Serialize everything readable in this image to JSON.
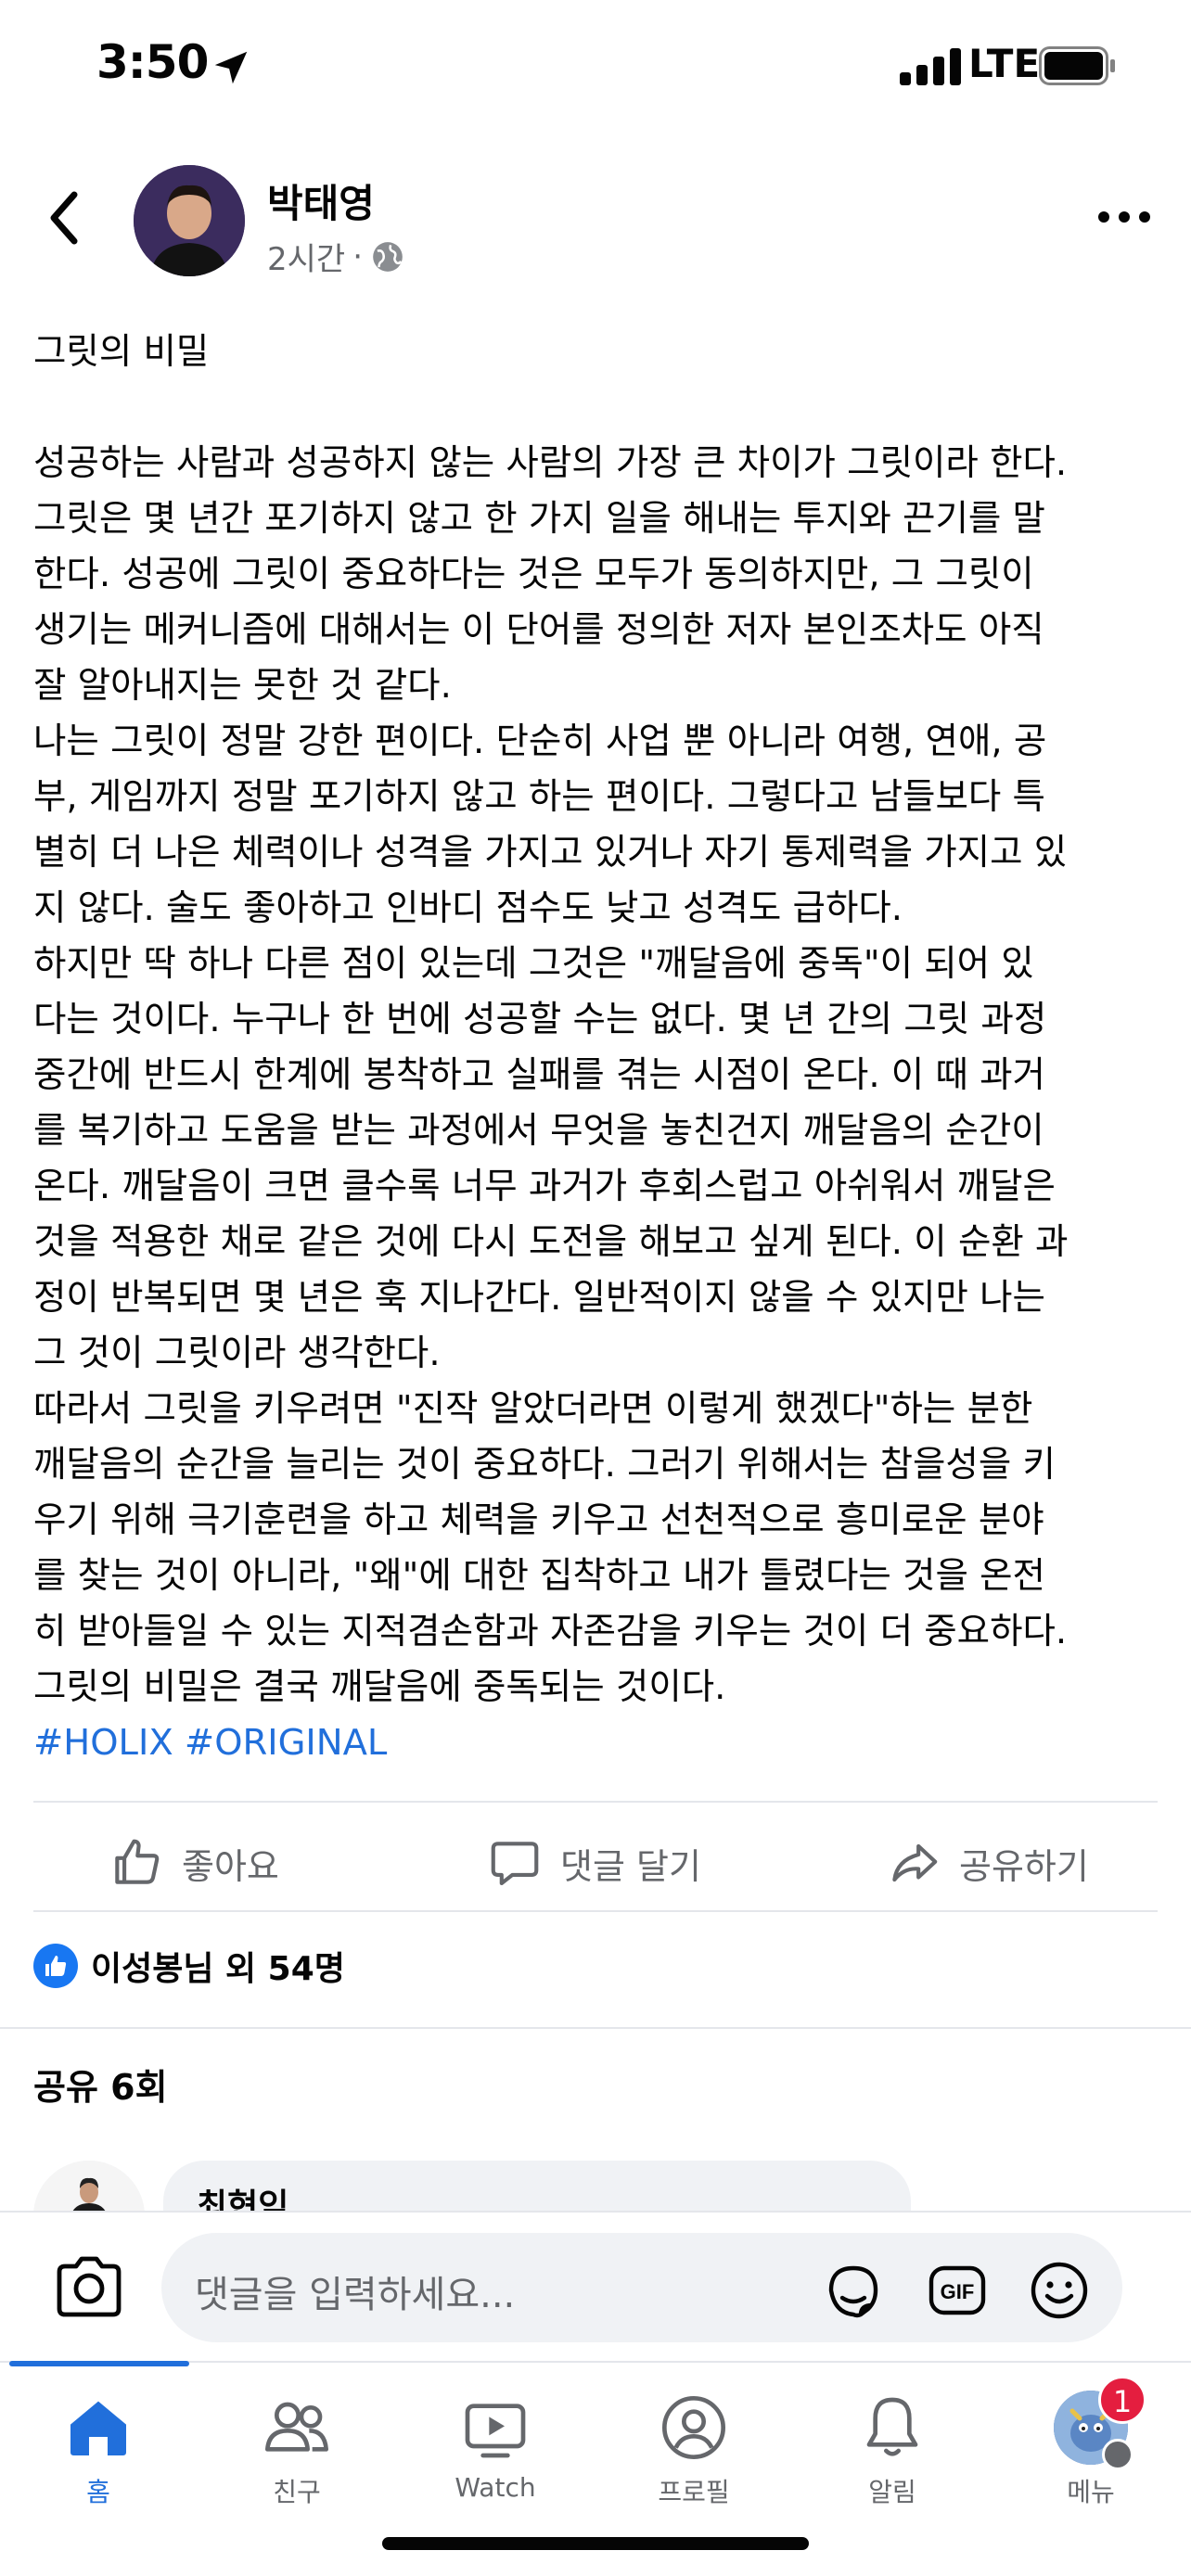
{
  "status_bar": {
    "time": "3:50",
    "network": "LTE"
  },
  "post": {
    "author": "박태영",
    "time_ago": "2시간",
    "separator": "·",
    "lines": [
      "그릿의 비밀",
      "",
      "성공하는 사람과 성공하지 않는 사람의 가장 큰 차이가 그릿이라 한다.",
      "그릿은 몇 년간 포기하지 않고 한 가지 일을 해내는 투지와 끈기를 말",
      "한다. 성공에 그릿이 중요하다는 것은 모두가 동의하지만, 그 그릿이",
      "생기는 메커니즘에 대해서는 이 단어를 정의한 저자 본인조차도 아직",
      "잘 알아내지는 못한 것 같다.",
      "나는 그릿이 정말 강한 편이다. 단순히 사업 뿐 아니라 여행, 연애, 공",
      "부, 게임까지 정말 포기하지 않고 하는 편이다. 그렇다고 남들보다 특",
      "별히 더 나은 체력이나 성격을 가지고 있거나 자기 통제력을 가지고 있",
      "지 않다. 술도 좋아하고 인바디 점수도 낮고 성격도 급하다.",
      "하지만 딱 하나 다른 점이 있는데 그것은 \"깨달음에 중독\"이 되어 있",
      "다는 것이다. 누구나 한 번에 성공할 수는 없다. 몇 년 간의 그릿 과정",
      "중간에 반드시 한계에 봉착하고 실패를 겪는 시점이 온다. 이 때 과거",
      "를 복기하고 도움을 받는 과정에서 무엇을 놓친건지 깨달음의 순간이",
      "온다. 깨달음이 크면 클수록 너무 과거가 후회스럽고 아쉬워서 깨달은",
      "것을 적용한 채로 같은 것에 다시 도전을 해보고 싶게 된다. 이 순환 과",
      "정이 반복되면 몇 년은 훅 지나간다. 일반적이지 않을 수 있지만 나는",
      "그 것이 그릿이라 생각한다.",
      "따라서 그릿을 키우려면 \"진작 알았더라면 이렇게 했겠다\"하는 분한",
      "깨달음의 순간을 늘리는 것이 중요하다. 그러기 위해서는 참을성을 키",
      "우기 위해 극기훈련을 하고 체력을 키우고 선천적으로 흥미로운 분야",
      "를 찾는 것이 아니라, \"왜\"에 대한 집착하고 내가 틀렸다는 것을 온전",
      "히 받아들일 수 있는 지적겸손함과 자존감을 키우는 것이 더 중요하다.",
      "그릿의 비밀은 결국 깨달음에 중독되는 것이다."
    ],
    "hashtags": "#HOLIX #ORIGINAL"
  },
  "actions": {
    "like": "좋아요",
    "comment": "댓글 달기",
    "share": "공유하기"
  },
  "reactions": {
    "summary": "이성봉님 외 54명"
  },
  "shares": {
    "label": "공유 6회"
  },
  "comment_preview": {
    "author": "최현익"
  },
  "composer": {
    "placeholder": "댓글을 입력하세요..."
  },
  "tabs": {
    "home": "홈",
    "friends": "친구",
    "watch": "Watch",
    "profile": "프로필",
    "notifications": "알림",
    "menu": "메뉴",
    "menu_badge": "1"
  },
  "colors": {
    "accent": "#216fdb",
    "text": "#050505",
    "secondary": "#65676b",
    "badge": "#e41e3f"
  }
}
